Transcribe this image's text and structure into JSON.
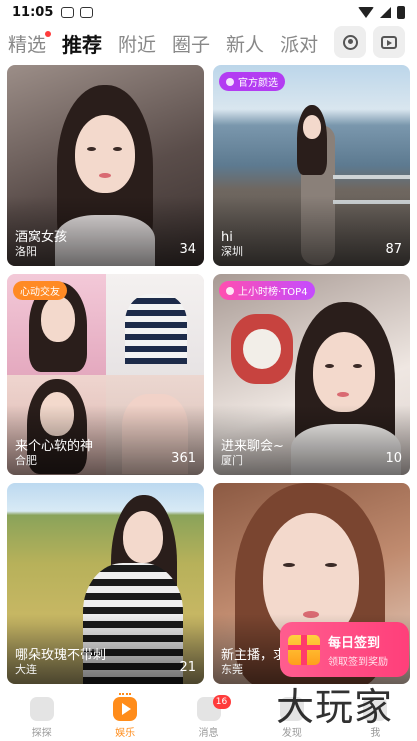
{
  "status_bar": {
    "time": "11:05"
  },
  "tabs": [
    {
      "label": "精选",
      "active": false,
      "dot": true
    },
    {
      "label": "推荐",
      "active": true,
      "dot": false
    },
    {
      "label": "附近",
      "active": false,
      "dot": false
    },
    {
      "label": "圈子",
      "active": false,
      "dot": false
    },
    {
      "label": "新人",
      "active": false,
      "dot": false
    },
    {
      "label": "派对",
      "active": false,
      "dot": false
    }
  ],
  "top_buttons": {
    "profile_icon": "profile-icon",
    "live_tv_icon": "tv-icon"
  },
  "cards": [
    {
      "title": "酒窝女孩",
      "city": "洛阳",
      "count": "34",
      "badge": ""
    },
    {
      "title": "hi",
      "city": "深圳",
      "count": "87",
      "badge": "官方颜选"
    },
    {
      "title": "来个心软的神",
      "city": "合肥",
      "count": "361",
      "badge": "心动交友"
    },
    {
      "title": "进来聊会~",
      "city": "厦门",
      "count": "10",
      "badge": "上小时榜·TOP4"
    },
    {
      "title": "哪朵玫瑰不带刺",
      "city": "大连",
      "count": "21",
      "badge": ""
    },
    {
      "title": "新主播，求",
      "city": "东莞",
      "count": "",
      "badge": ""
    }
  ],
  "promo": {
    "title": "每日签到",
    "subtitle": "领取签到奖励"
  },
  "watermark": "大玩家",
  "bottom_nav": [
    {
      "label": "探探",
      "active": false,
      "badge": ""
    },
    {
      "label": "娱乐",
      "active": true,
      "badge": ""
    },
    {
      "label": "消息",
      "active": false,
      "badge": "16"
    },
    {
      "label": "发现",
      "active": false,
      "badge": ""
    },
    {
      "label": "我",
      "active": false,
      "badge": ""
    }
  ],
  "colors": {
    "accent": "#ff8c1a",
    "badge_red": "#ff3b3b",
    "official_purple": "#b33cf2",
    "promo_pink": "#ff4f86"
  }
}
